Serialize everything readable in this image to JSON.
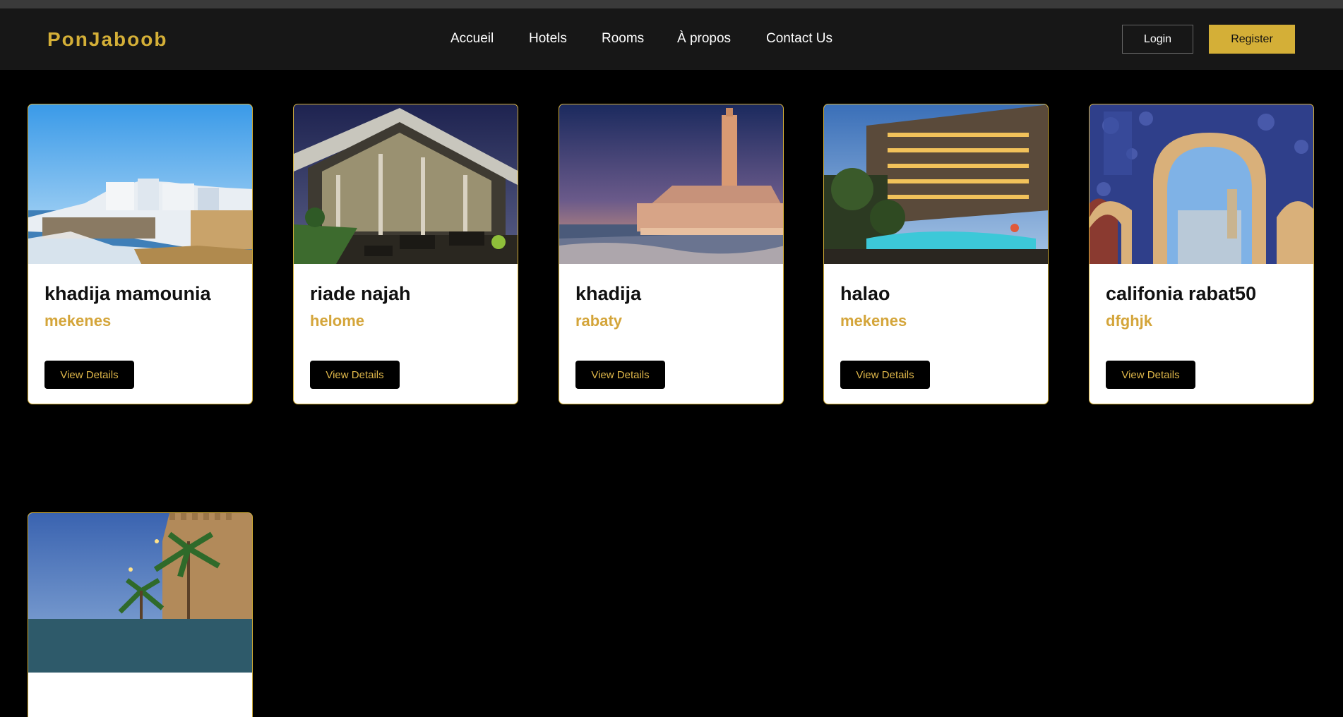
{
  "brand": {
    "logo": "PonJaboob",
    "accent": "#d4af37"
  },
  "nav": {
    "links": [
      "Accueil",
      "Hotels",
      "Rooms",
      "À propos",
      "Contact Us"
    ],
    "login": "Login",
    "register": "Register"
  },
  "hotels": [
    {
      "name": "khadija mamounia",
      "city": "mekenes",
      "button": "View Details",
      "image": "coastal-town-photo"
    },
    {
      "name": "riade najah",
      "city": "helome",
      "button": "View Details",
      "image": "pavilion-terrace-photo"
    },
    {
      "name": "khadija",
      "city": "rabaty",
      "button": "View Details",
      "image": "mosque-sunset-photo"
    },
    {
      "name": "halao",
      "city": "mekenes",
      "button": "View Details",
      "image": "resort-pool-photo"
    },
    {
      "name": "califonia rabat50",
      "city": "dfghjk",
      "button": "View Details",
      "image": "moroccan-gate-photo"
    },
    {
      "name": "",
      "city": "",
      "button": "",
      "image": "palm-kasbah-photo"
    }
  ]
}
